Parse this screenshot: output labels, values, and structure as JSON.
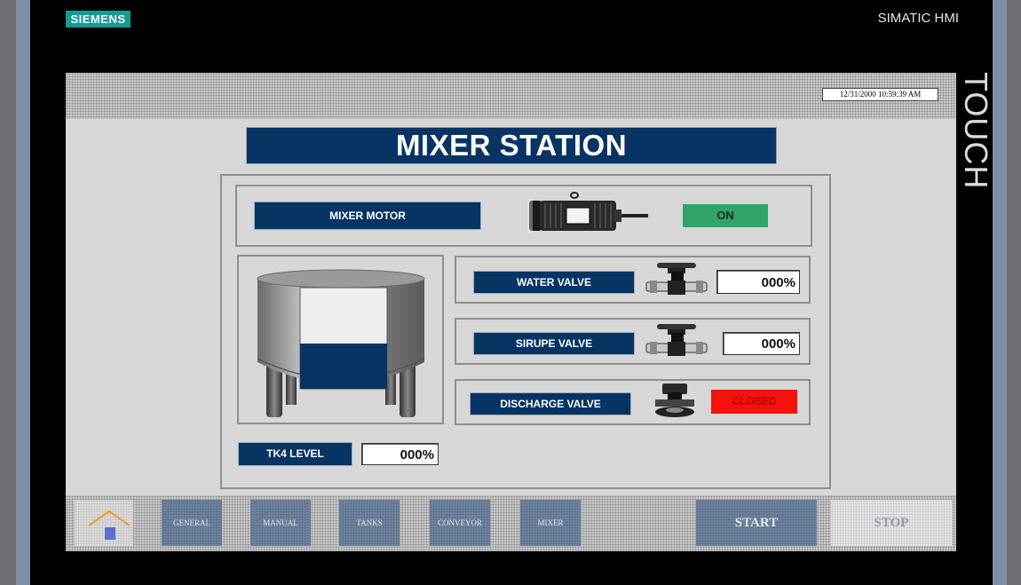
{
  "device": {
    "brand": "SIEMENS",
    "model": "SIMATIC HMI",
    "touch_label": "TOUCH",
    "colors": {
      "brand": "#149b93",
      "screen_bg": "#d7d7d7"
    }
  },
  "screen": {
    "datetime": "12/31/2000 10:59:39 AM",
    "title": "MIXER STATION",
    "colors": {
      "banner": "#083464",
      "status_on": "#33a36c",
      "status_closed": "#f4120d"
    }
  },
  "motor": {
    "label": "MIXER MOTOR",
    "status": "ON",
    "icon": "motor-icon"
  },
  "valves": [
    {
      "label": "WATER VALVE",
      "value": "000%",
      "icon": "valve-icon"
    },
    {
      "label": "SIRUPE VALVE",
      "value": "000%",
      "icon": "valve-icon"
    },
    {
      "label": "DISCHARGE VALVE",
      "status": "CLOSED",
      "icon": "discharge-valve-icon"
    }
  ],
  "tank": {
    "label": "TK4 LEVEL",
    "value": "000%",
    "icon": "tank-icon",
    "fill_level": 0.45
  },
  "nav": {
    "home_icon": "home-icon",
    "buttons": [
      "GENERAL",
      "MANUAL",
      "TANKS",
      "CONVEYOR",
      "MIXER"
    ],
    "start": "START",
    "stop": "STOP"
  }
}
